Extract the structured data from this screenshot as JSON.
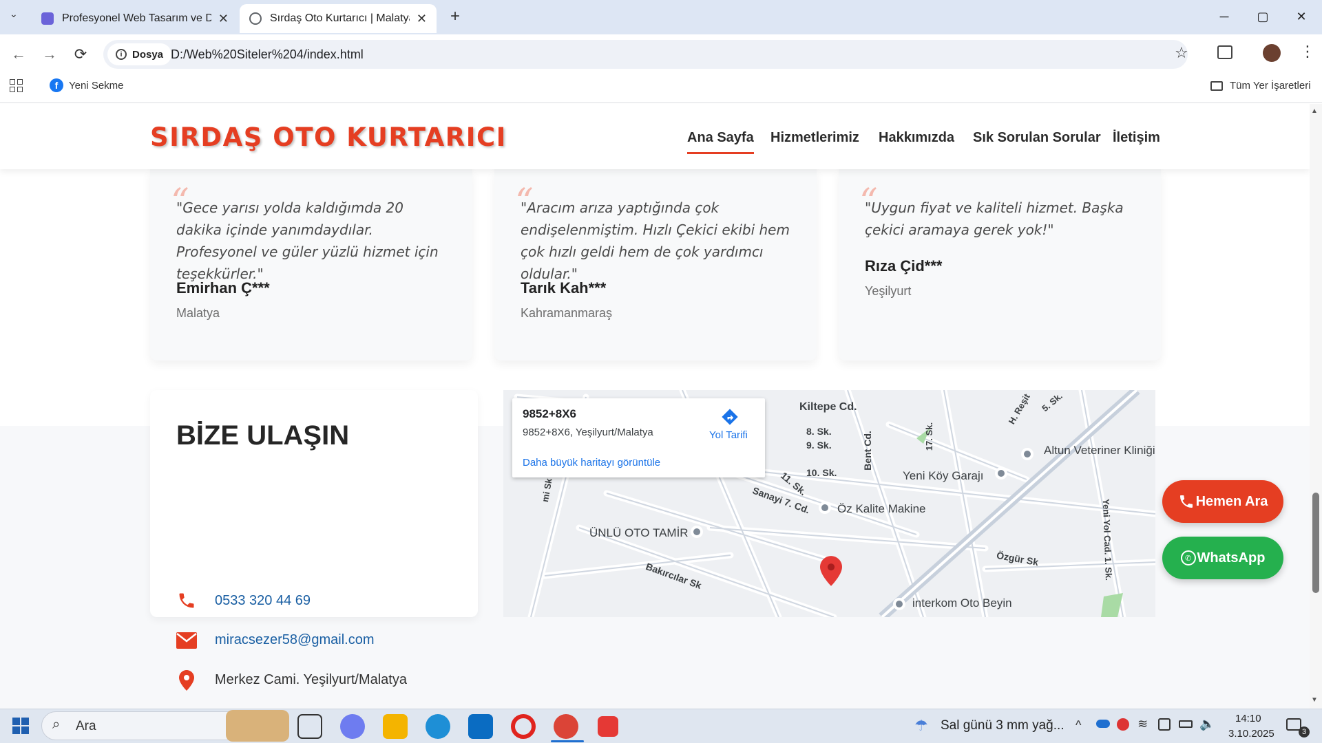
{
  "browser": {
    "tabs": [
      {
        "title": "Profesyonel Web Tasarım ve Dij",
        "active": false
      },
      {
        "title": "Sırdaş Oto Kurtarıcı | Malatya |",
        "active": true
      }
    ],
    "new_tab": "+",
    "nav": {
      "back": "←",
      "forward": "→",
      "reload": "⟳"
    },
    "chip_label": "Dosya",
    "url": "D:/Web%20Siteler%204/index.html",
    "bookmark_bar": {
      "item": "Yeni Sekme",
      "all_bookmarks": "Tüm Yer İşaretleri"
    },
    "window_controls": {
      "minimize": "─",
      "maximize": "▢",
      "close": "✕"
    }
  },
  "site": {
    "logo": "SIRDAŞ OTO KURTARICI",
    "nav": [
      "Ana Sayfa",
      "Hizmetlerimiz",
      "Hakkımızda",
      "Sık Sorulan Sorular",
      "İletişim"
    ],
    "accent": "#e53e22",
    "testimonials": [
      {
        "quote": "\"Gece yarısı yolda kaldığımda 20 dakika içinde yanımdaydılar. Profesyonel ve güler yüzlü hizmet için teşekkürler.\"",
        "author": "Emirhan Ç***",
        "city": "Malatya"
      },
      {
        "quote": "\"Aracım arıza yaptığında çok endişelenmiştim. Hızlı Çekici ekibi hem çok hızlı geldi hem de çok yardımcı oldular.\"",
        "author": "Tarık Kah***",
        "city": "Kahramanmaraş"
      },
      {
        "quote": "\"Uygun fiyat ve kaliteli hizmet. Başka çekici aramaya gerek yok!\"",
        "author": "Rıza Çid***",
        "city": "Yeşilyurt"
      }
    ],
    "contact": {
      "title": "BİZE ULAŞIN",
      "phone": "0533 320 44 69",
      "email": "miracsezer58@gmail.com",
      "address": "Merkez Cami. Yeşilyurt/Malatya"
    },
    "map": {
      "popup_title": "9852+8X6",
      "popup_address": "9852+8X6, Yeşilyurt/Malatya",
      "directions": "Yol Tarifi",
      "larger_map": "Daha büyük haritayı görüntüle",
      "streets": [
        "Kiltepe Cd.",
        "8. Sk.",
        "9. Sk.",
        "10. Sk.",
        "11. Sk.",
        "Bent Cd.",
        "17. Sk.",
        "H. Reşit",
        "5. Sk.",
        "Sanayi 7. Cd.",
        "Bakırcılar Sk",
        "Özgür Sk",
        "Yeni Yol Cad. 1. Sk.",
        "mi Sk"
      ],
      "places": [
        "Altun Veteriner Kliniği",
        "Yeni Köy Garajı",
        "Öz Kalite Makine",
        "ÜNLÜ OTO TAMİR",
        "interkom Oto Beyin"
      ]
    },
    "floating": {
      "call": "Hemen Ara",
      "whatsapp": "WhatsApp"
    }
  },
  "taskbar": {
    "search": "Ara",
    "weather": "Sal günü 3 mm yağ...",
    "time": "14:10",
    "date": "3.10.2025",
    "notifications": "3"
  }
}
